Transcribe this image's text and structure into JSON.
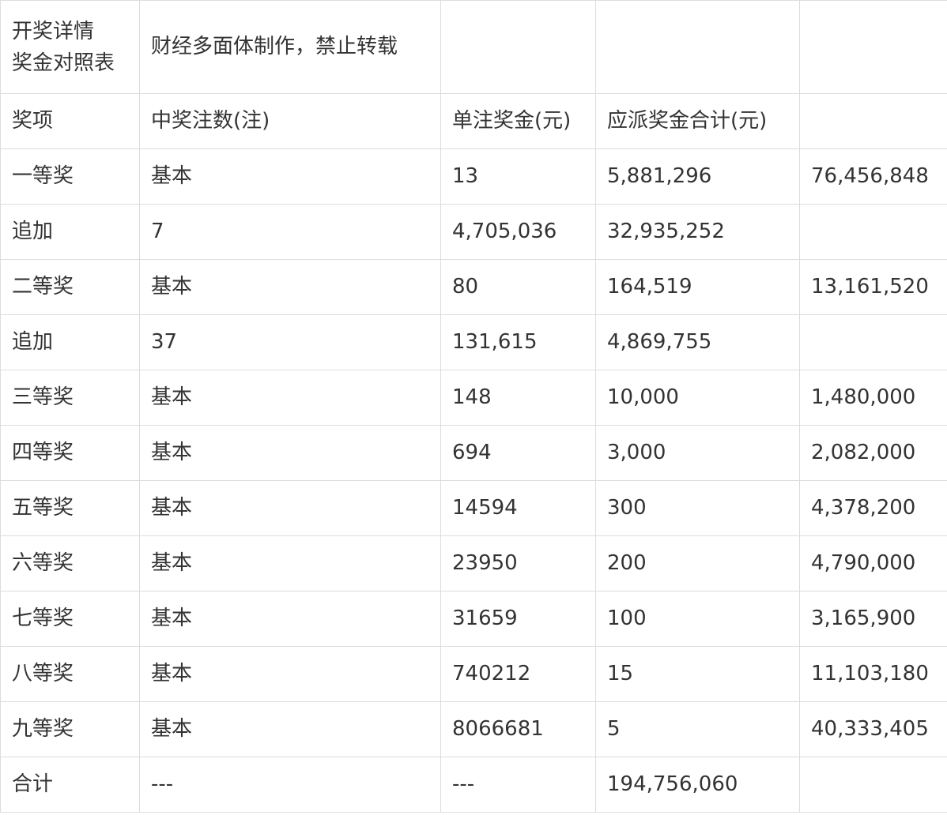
{
  "title": {
    "line1": "开奖详情",
    "line2": "奖金对照表",
    "note": "财经多面体制作，禁止转载"
  },
  "headers": [
    "奖项",
    "中奖注数(注)",
    "单注奖金(元)",
    "应派奖金合计(元)",
    ""
  ],
  "rows": [
    [
      "一等奖",
      "基本",
      "13",
      "5,881,296",
      "76,456,848"
    ],
    [
      "追加",
      "7",
      "4,705,036",
      "32,935,252",
      ""
    ],
    [
      "二等奖",
      "基本",
      "80",
      "164,519",
      "13,161,520"
    ],
    [
      "追加",
      "37",
      "131,615",
      "4,869,755",
      ""
    ],
    [
      "三等奖",
      "基本",
      "148",
      "10,000",
      "1,480,000"
    ],
    [
      "四等奖",
      "基本",
      "694",
      "3,000",
      "2,082,000"
    ],
    [
      "五等奖",
      "基本",
      "14594",
      "300",
      "4,378,200"
    ],
    [
      "六等奖",
      "基本",
      "23950",
      "200",
      "4,790,000"
    ],
    [
      "七等奖",
      "基本",
      "31659",
      "100",
      "3,165,900"
    ],
    [
      "八等奖",
      "基本",
      "740212",
      "15",
      "11,103,180"
    ],
    [
      "九等奖",
      "基本",
      "8066681",
      "5",
      "40,333,405"
    ],
    [
      "合计",
      "---",
      "---",
      "194,756,060",
      ""
    ]
  ]
}
